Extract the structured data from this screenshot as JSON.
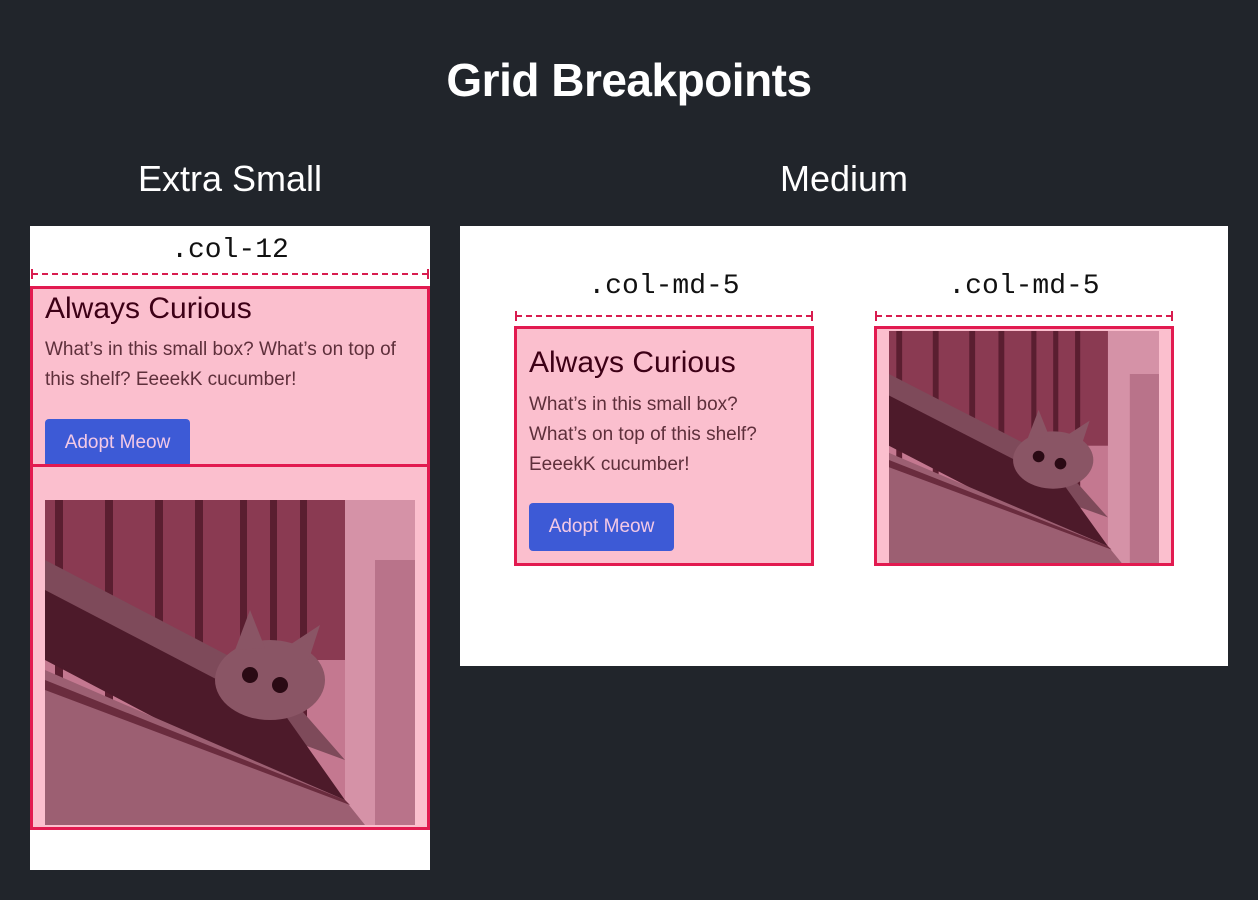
{
  "title": "Grid Breakpoints",
  "xs": {
    "heading": "Extra Small",
    "class_label": ".col-12",
    "card": {
      "title": "Always Curious",
      "text": "What’s in this small box? What’s on top of this shelf? EeeekK cucumber!",
      "button": "Adopt Meow"
    }
  },
  "md": {
    "heading": "Medium",
    "class_label_left": ".col-md-5",
    "class_label_right": ".col-md-5",
    "card": {
      "title": "Always Curious",
      "text": "What’s in this small box? What’s on top of this shelf? EeeekK cucumber!",
      "button": "Adopt Meow"
    }
  },
  "colors": {
    "background": "#21252b",
    "column_fill": "#fbbfce",
    "column_border": "#e21a50",
    "button": "#3d5ad6"
  },
  "icons": {
    "photo": "cat-on-balcony-image"
  }
}
